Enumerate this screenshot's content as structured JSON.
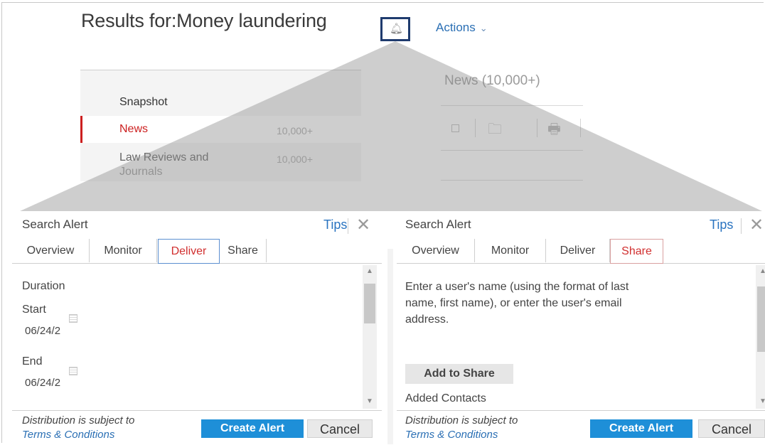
{
  "header": {
    "title": "Results for:Money laundering",
    "actions_label": "Actions"
  },
  "nav": {
    "items": [
      {
        "label": "Snapshot",
        "count": ""
      },
      {
        "label": "News",
        "count": "10,000+"
      },
      {
        "label": "Law Reviews and",
        "label2": "Journals",
        "count": "10,000+"
      }
    ]
  },
  "news": {
    "heading": "News (10,000+)"
  },
  "left_panel": {
    "title": "Search Alert",
    "tips": "Tips",
    "tabs": [
      "Overview",
      "Monitor",
      "Deliver",
      "Share"
    ],
    "active_tab": "Deliver",
    "duration_label": "Duration",
    "start_label": "Start",
    "start_value": "06/24/2",
    "end_label": "End",
    "end_value": "06/24/2",
    "footer_text": "Distribution is subject to",
    "footer_link": "Terms & Conditions",
    "create_button": "Create Alert",
    "cancel_button": "Cancel"
  },
  "right_panel": {
    "title": "Search Alert",
    "tips": "Tips",
    "tabs": [
      "Overview",
      "Monitor",
      "Deliver",
      "Share"
    ],
    "active_tab": "Share",
    "instructions_1": "Enter a user's name (using the format of last",
    "instructions_2": "name, first name), or enter the user's email",
    "instructions_3": "address.",
    "add_button": "Add to Share",
    "added_contacts": "Added Contacts",
    "footer_text": "Distribution is subject to",
    "footer_link": "Terms & Conditions",
    "create_button": "Create Alert",
    "cancel_button": "Cancel"
  },
  "colors": {
    "accent_blue": "#2a6fb4",
    "button_blue": "#1e8fd8",
    "active_red": "#cc1f1f",
    "highlight_border": "#1f3b6e"
  },
  "icons": [
    "bell-icon",
    "chevron-down-icon",
    "folder-icon",
    "print-icon",
    "close-icon",
    "calendar-icon"
  ]
}
